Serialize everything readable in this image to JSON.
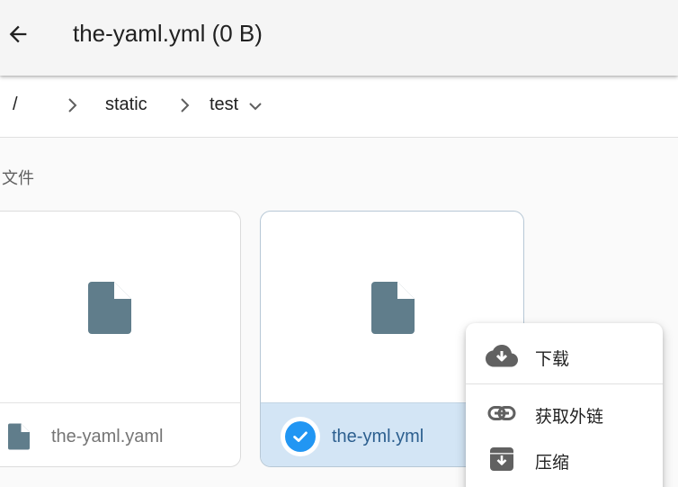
{
  "header": {
    "title": "the-yaml.yml (0 B)",
    "back_icon": "arrow-back-icon"
  },
  "breadcrumb": {
    "root": "/",
    "items": [
      "static",
      "test"
    ],
    "separator_icon": "chevron-right-icon",
    "dropdown_icon": "chevron-down-icon"
  },
  "section": {
    "title": "文件"
  },
  "files": [
    {
      "name": "the-yaml.yaml",
      "icon": "file-icon",
      "selected": false
    },
    {
      "name": "the-yml.yml",
      "icon": "file-icon",
      "selected": true
    }
  ],
  "context_menu": {
    "items": [
      {
        "label": "下载",
        "icon": "cloud-download-icon"
      },
      {
        "label": "获取外链",
        "icon": "link-icon"
      },
      {
        "label": "压缩",
        "icon": "archive-icon"
      }
    ]
  },
  "colors": {
    "file_icon": "#607d8b",
    "selected_bg": "#d3e5f5",
    "check_blue": "#2196f3",
    "menu_icon": "#616161"
  }
}
